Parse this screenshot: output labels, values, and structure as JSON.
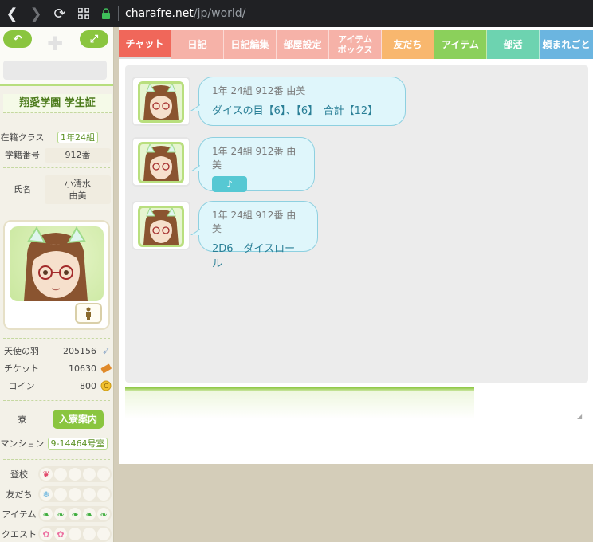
{
  "browser": {
    "url_host": "charafre.net",
    "url_path": "/jp/world/"
  },
  "sidebar": {
    "id_card_title": "翔愛学園 学生証",
    "class_label": "在籍クラス",
    "class_value": "1年24組",
    "student_no_label": "学籍番号",
    "student_no_value": "912番",
    "name_label": "氏名",
    "name_line1": "小清水",
    "name_line2": "由美",
    "stats": [
      {
        "label": "天使の羽",
        "value": "205156",
        "icon": "feather-icon"
      },
      {
        "label": "チケット",
        "value": "10630",
        "icon": "ticket-icon"
      },
      {
        "label": "コイン",
        "value": "800",
        "icon": "coin-icon"
      }
    ],
    "dorm_label": "寮",
    "dorm_button": "入寮案内",
    "mansion_label": "マンション",
    "mansion_value": "9-14464号室",
    "progress": [
      {
        "label": "登校",
        "filled": 1,
        "total": 5,
        "icon": "heart-flower-icon"
      },
      {
        "label": "友だち",
        "filled": 1,
        "total": 5,
        "icon": "snowflake-icon"
      },
      {
        "label": "アイテム",
        "filled": 5,
        "total": 5,
        "icon": "leaf-icon"
      },
      {
        "label": "クエスト",
        "filled": 2,
        "total": 5,
        "icon": "sakura-icon"
      }
    ]
  },
  "tabs": [
    {
      "label": "チャット",
      "color": "#f0675a",
      "active": true
    },
    {
      "label": "日記",
      "color": "#f6b2a8"
    },
    {
      "label": "日記編集",
      "color": "#f6b2a8"
    },
    {
      "label": "部屋設定",
      "color": "#f6b2a8"
    },
    {
      "label": "アイテムボックス",
      "color": "#f6b2a8"
    },
    {
      "label": "友だち",
      "color": "#f8b76e"
    },
    {
      "label": "アイテム",
      "color": "#8bd05b"
    },
    {
      "label": "部活",
      "color": "#6dd3b0"
    },
    {
      "label": "頼まれごと",
      "color": "#6bb5e0"
    }
  ],
  "chat": {
    "messages": [
      {
        "speaker": "1年 24組 912番 由美",
        "text": "ダイスの目【6】、【6】　合計【12】",
        "type": "text"
      },
      {
        "speaker": "1年 24組 912番 由美",
        "text": "♪",
        "type": "music"
      },
      {
        "speaker": "1年 24組 912番 由美",
        "text": "2D6　ダイスロール",
        "type": "text"
      }
    ]
  }
}
